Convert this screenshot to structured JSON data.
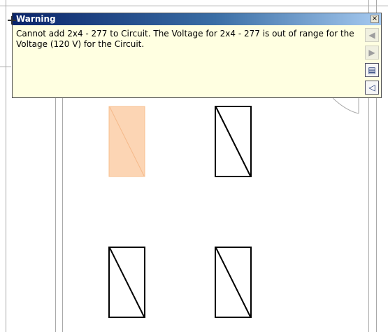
{
  "dialog": {
    "title": "Warning",
    "message": "Cannot add 2x4 - 277 to Circuit. The Voltage for 2x4 - 277 is out of range for the Voltage (120 V) for the Circuit.",
    "buttons": [
      {
        "name": "close-button",
        "label": "×",
        "icon": "close-icon",
        "enabled": true
      },
      {
        "name": "previous-button",
        "label": "◀",
        "icon": "arrow-left-icon",
        "enabled": false
      },
      {
        "name": "next-button",
        "label": "▶",
        "icon": "arrow-right-icon",
        "enabled": false
      },
      {
        "name": "show-dialog-button",
        "label": "▤",
        "icon": "dialog-icon",
        "enabled": true
      },
      {
        "name": "sound-button",
        "label": "◁",
        "icon": "speaker-icon",
        "enabled": true
      }
    ]
  },
  "canvas": {
    "fixtures": [
      {
        "name": "fixture-selected",
        "state": "selected",
        "color": "#fcd5b4"
      },
      {
        "name": "fixture",
        "state": "normal"
      },
      {
        "name": "fixture",
        "state": "normal"
      },
      {
        "name": "fixture",
        "state": "normal"
      }
    ]
  },
  "colors": {
    "dialog_bg": "#ffffe1",
    "title_bar": "#0a246a",
    "selection": "#fcd5b4"
  }
}
